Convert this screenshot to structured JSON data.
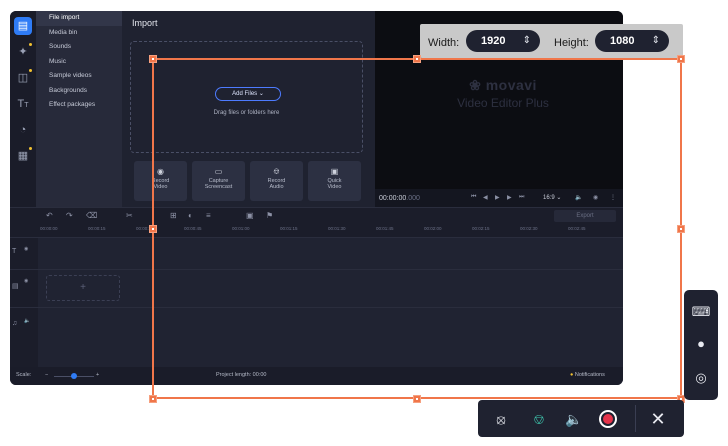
{
  "sidebar": {
    "icons": [
      "import-icon",
      "magic-wand-icon",
      "transitions-icon",
      "titles-icon",
      "stickers-icon",
      "more-tools-icon"
    ],
    "menu": [
      "File import",
      "Media bin",
      "Sounds",
      "Music",
      "Sample videos",
      "Backgrounds",
      "Effect packages"
    ]
  },
  "import": {
    "title": "Import",
    "add_files": "Add Files",
    "drag_text": "Drag files or folders here",
    "tiles": [
      {
        "icon": "webcam-icon",
        "label1": "Record",
        "label2": "Video"
      },
      {
        "icon": "screen-capture-icon",
        "label1": "Capture",
        "label2": "Screencast"
      },
      {
        "icon": "microphone-icon",
        "label1": "Record",
        "label2": "Audio"
      },
      {
        "icon": "quick-video-icon",
        "label1": "Quick",
        "label2": "Video"
      }
    ]
  },
  "player": {
    "logo_name": "movavi",
    "logo_sub": "Video Editor Plus",
    "timecode_main": "00:00:00",
    "timecode_ms": ".000",
    "aspect": "16:9"
  },
  "timeline": {
    "export_label": "Export",
    "ruler": [
      "00:00:00",
      "00:00:15",
      "00:00:30",
      "00:00:45",
      "00:01:00",
      "00:01:15",
      "00:01:30",
      "00:01:45",
      "00:02:00",
      "00:02:15",
      "00:02:30",
      "00:02:45"
    ],
    "plus": "+"
  },
  "status": {
    "scale_label": "Scale:",
    "project_length": "Project length:  00:00",
    "notifications": "Notifications"
  },
  "capture": {
    "width_label": "Width:",
    "width_value": "1920",
    "height_label": "Height:",
    "height_value": "1080",
    "accent_color": "#f0764a",
    "record_color": "#e5344a"
  },
  "side_tools": [
    "keyboard-icon",
    "cursor-highlight-icon",
    "click-effect-icon"
  ],
  "record_controls": [
    "webcam-off-icon",
    "microphone-icon",
    "speaker-icon",
    "record-icon",
    "close-icon"
  ]
}
